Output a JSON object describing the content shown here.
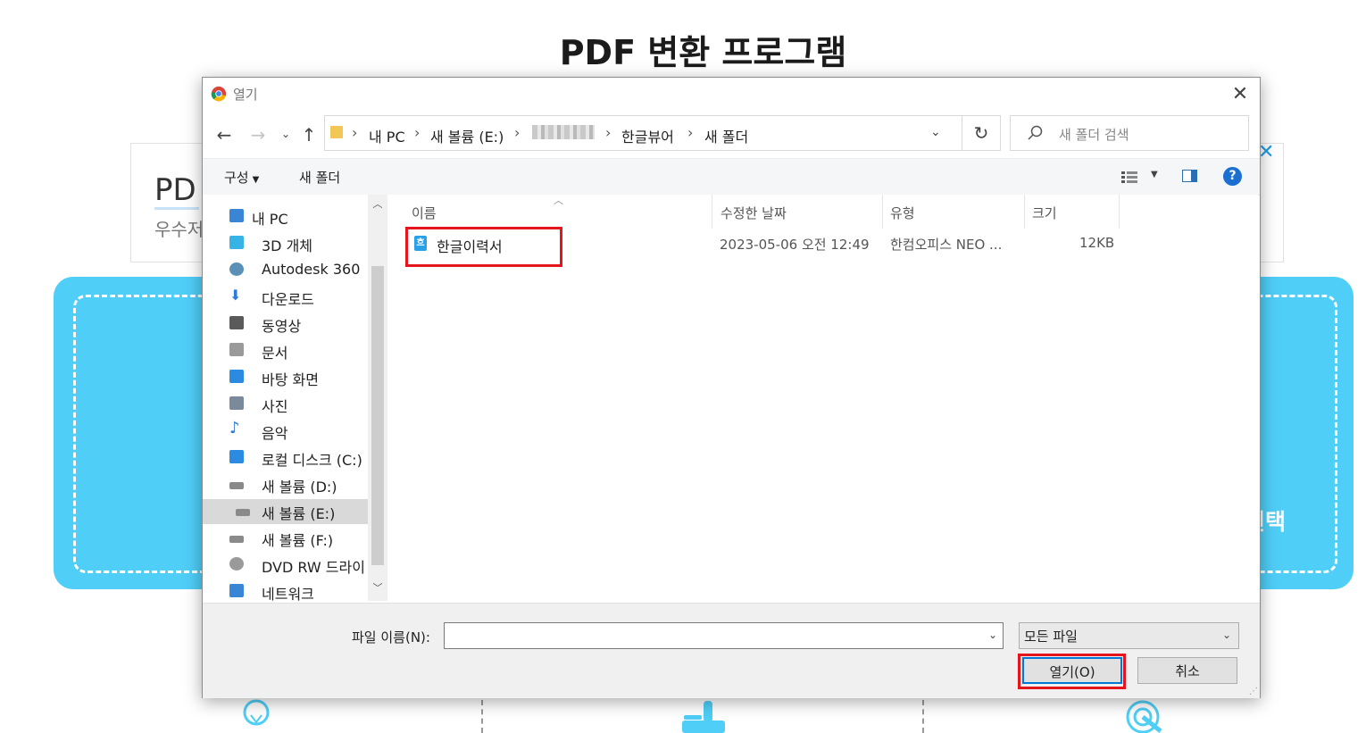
{
  "page": {
    "title": "PDF 변환 프로그램",
    "ad_title": "PD",
    "ad_subtitle": "우수저",
    "upload_label": "선택"
  },
  "dialog": {
    "title": "열기",
    "address": [
      "내 PC",
      "새 볼륨 (E:)",
      "한글뷰어",
      "새 폴더"
    ],
    "search_placeholder": "새 폴더 검색",
    "commands": {
      "organize": "구성",
      "new_folder": "새 폴더"
    },
    "nav_items": [
      {
        "label": "내 PC",
        "icon": "pc-icon"
      },
      {
        "label": "3D 개체",
        "icon": "cube-3d-icon"
      },
      {
        "label": "Autodesk 360",
        "icon": "autodesk-cloud-icon"
      },
      {
        "label": "다운로드",
        "icon": "download-arrow-icon"
      },
      {
        "label": "동영상",
        "icon": "video-film-icon"
      },
      {
        "label": "문서",
        "icon": "document-icon"
      },
      {
        "label": "바탕 화면",
        "icon": "desktop-icon"
      },
      {
        "label": "사진",
        "icon": "picture-icon"
      },
      {
        "label": "음악",
        "icon": "music-note-icon"
      },
      {
        "label": "로컬 디스크 (C:)",
        "icon": "windows-drive-icon"
      },
      {
        "label": "새 볼륨 (D:)",
        "icon": "drive-icon"
      },
      {
        "label": "새 볼륨 (E:)",
        "icon": "drive-icon"
      },
      {
        "label": "새 볼륨 (F:)",
        "icon": "drive-icon"
      },
      {
        "label": "DVD RW 드라이",
        "icon": "dvd-drive-icon"
      },
      {
        "label": "네트워크",
        "icon": "network-icon"
      }
    ],
    "selected_nav": "새 볼륨 (E:)",
    "columns": [
      "이름",
      "수정한 날짜",
      "유형",
      "크기"
    ],
    "files": [
      {
        "name": "한글이력서",
        "modified": "2023-05-06 오전 12:49",
        "type": "한컴오피스 NEO ...",
        "size": "12KB",
        "icon_char": "흐"
      }
    ],
    "filename_label": "파일 이름(N):",
    "filename_value": "",
    "filetype": "모든 파일",
    "open_button": "열기(O)",
    "cancel_button": "취소"
  },
  "colors": {
    "upload_bg": "#4fcef7",
    "highlight": "#e6141c",
    "accent": "#0078d7"
  }
}
